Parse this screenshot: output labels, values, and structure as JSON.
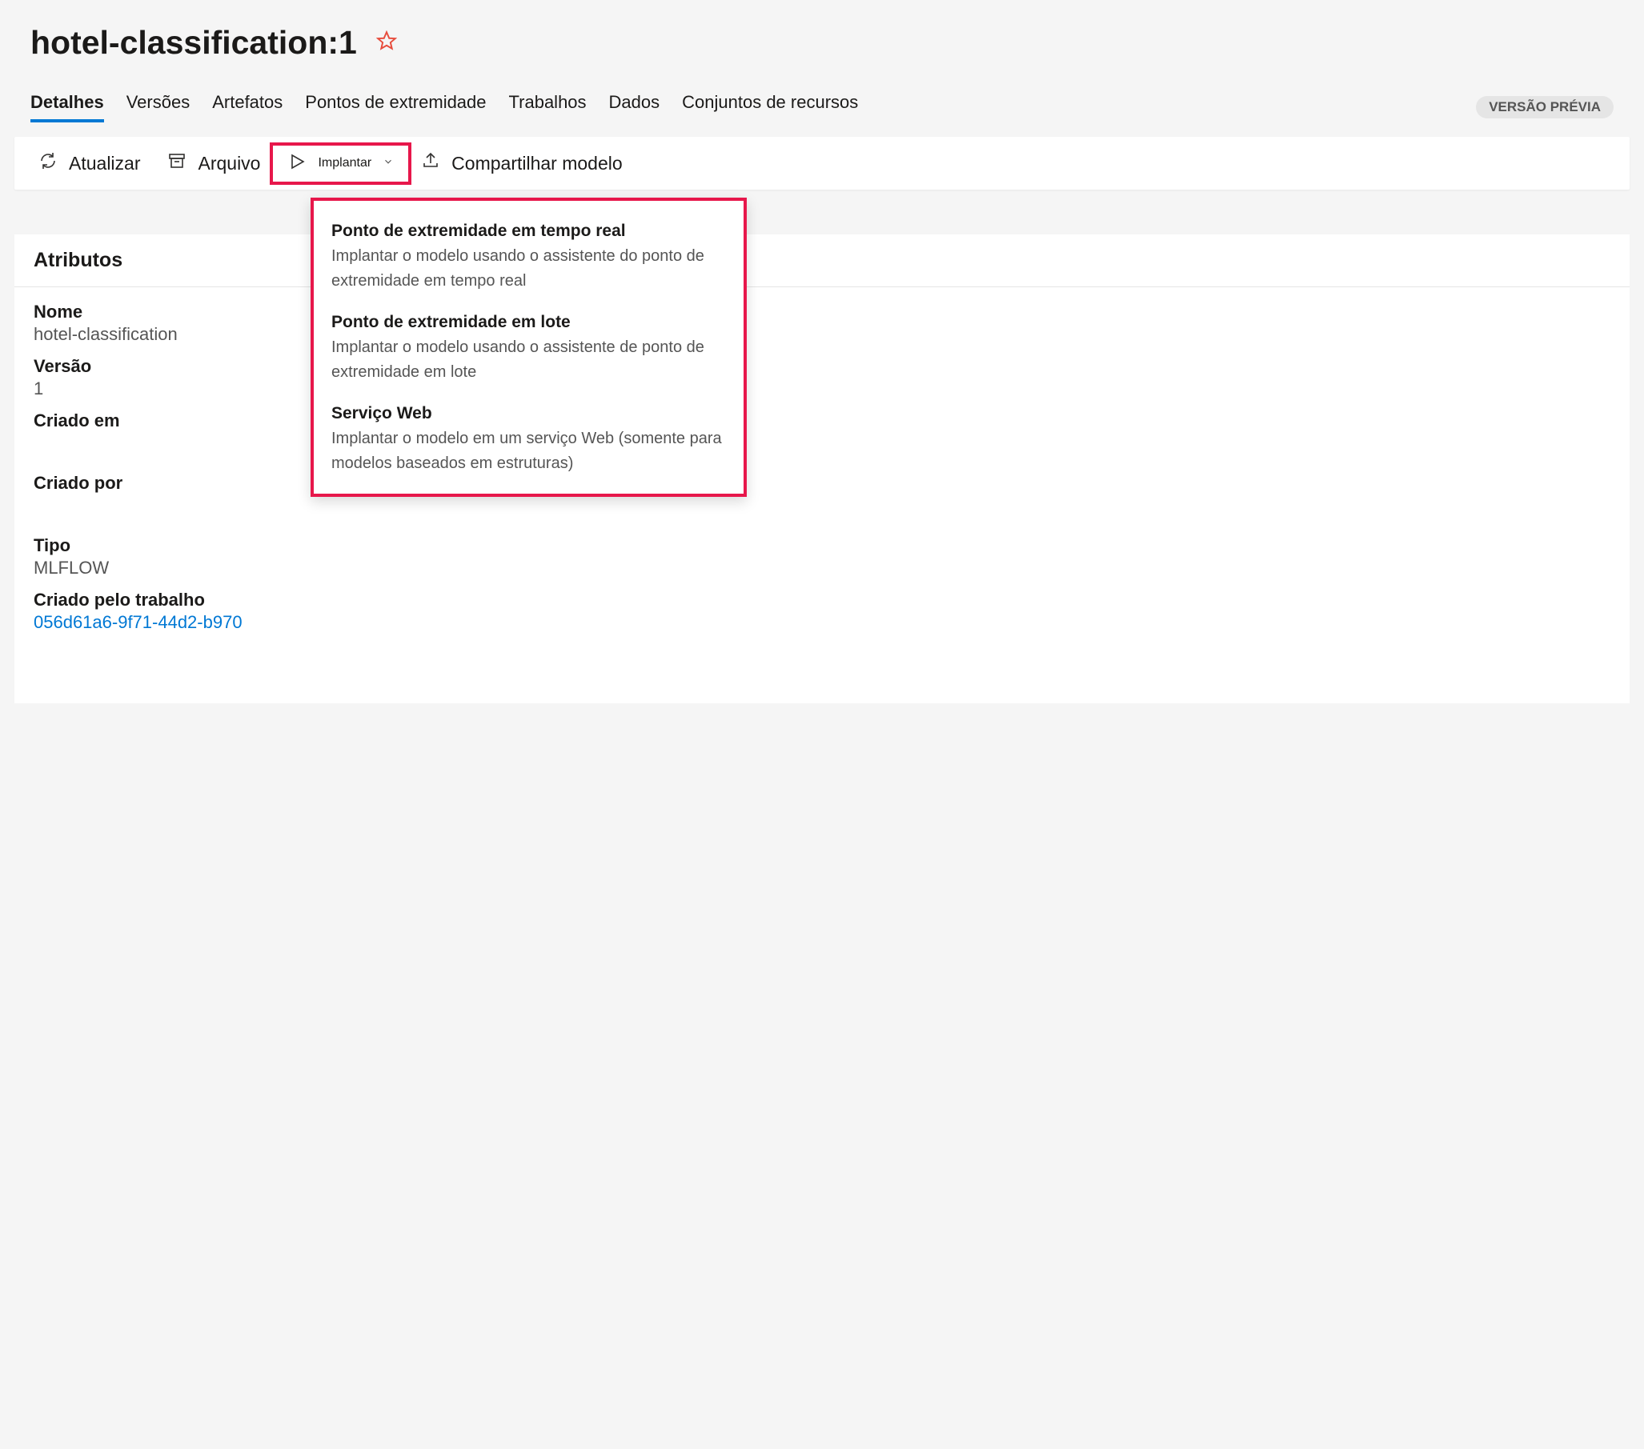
{
  "header": {
    "title": "hotel-classification:1"
  },
  "tabs": {
    "items": [
      "Detalhes",
      "Versões",
      "Artefatos",
      "Pontos de extremidade",
      "Trabalhos",
      "Dados",
      "Conjuntos de recursos"
    ],
    "badge": "VERSÃO PRÉVIA"
  },
  "toolbar": {
    "refresh": "Atualizar",
    "archive": "Arquivo",
    "deploy": "Implantar",
    "share": "Compartilhar modelo"
  },
  "dropdown": {
    "items": [
      {
        "title": "Ponto de extremidade em tempo real",
        "desc": "Implantar o modelo usando o assistente do ponto de extremidade em tempo real"
      },
      {
        "title": "Ponto de extremidade em lote",
        "desc": "Implantar o modelo usando o assistente de ponto de extremidade em lote"
      },
      {
        "title": "Serviço Web",
        "desc": "Implantar o modelo em um serviço Web (somente para modelos baseados em estruturas)"
      }
    ]
  },
  "section": {
    "title": "Atributos"
  },
  "attrs": {
    "name_label": "Nome",
    "name_value": "hotel-classification",
    "version_label": "Versão",
    "version_value": "1",
    "created_label": "Criado em",
    "createdby_label": "Criado por",
    "type_label": "Tipo",
    "type_value": "MLFLOW",
    "job_label": "Criado pelo trabalho",
    "job_value": "056d61a6-9f71-44d2-b970"
  }
}
